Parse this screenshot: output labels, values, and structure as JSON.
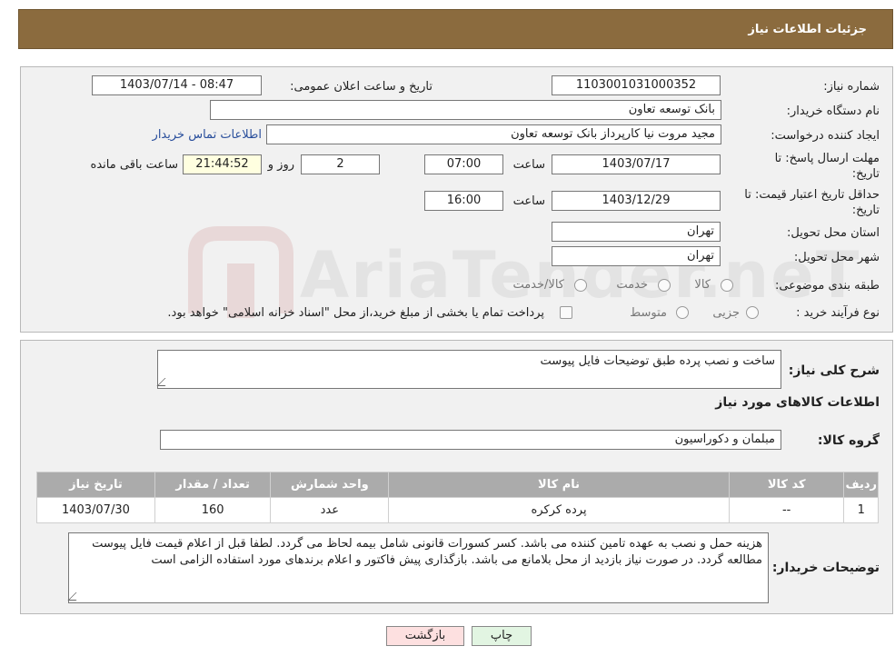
{
  "header": {
    "title": "جزئیات اطلاعات نیاز"
  },
  "details": {
    "need_number_label": "شماره نیاز:",
    "need_number": "1103001031000352",
    "announce_label": "تاریخ و ساعت اعلان عمومی:",
    "announce_value": "1403/07/14 - 08:47",
    "buyer_label": "نام دستگاه خریدار:",
    "buyer_value": "بانک توسعه تعاون",
    "creator_label": "ایجاد کننده درخواست:",
    "creator_value": "مجید مروت نیا کارپرداز بانک توسعه تعاون",
    "contact_link": "اطلاعات تماس خریدار",
    "deadline_label_1": "مهلت ارسال پاسخ: تا",
    "deadline_label_2": "تاریخ:",
    "deadline_date": "1403/07/17",
    "time_label": "ساعت",
    "deadline_time": "07:00",
    "days_value": "2",
    "days_label": "روز و",
    "remaining_time": "21:44:52",
    "remaining_label": "ساعت باقی مانده",
    "validity_label_1": "حداقل تاریخ اعتبار قیمت: تا",
    "validity_label_2": "تاریخ:",
    "validity_date": "1403/12/29",
    "validity_time": "16:00",
    "province_label": "استان محل تحویل:",
    "province_value": "تهران",
    "city_label": "شهر محل تحویل:",
    "city_value": "تهران",
    "category_label": "طبقه بندی موضوعی:",
    "category_options": [
      "کالا",
      "خدمت",
      "کالا/خدمت"
    ],
    "process_label": "نوع فرآیند خرید :",
    "process_options": [
      "جزیی",
      "متوسط"
    ],
    "process_note": "پرداخت تمام یا بخشی از مبلغ خرید،از محل \"اسناد خزانه اسلامی\" خواهد بود."
  },
  "summary": {
    "general_label": "شرح کلی نیاز:",
    "general_value": "ساخت و نصب پرده طبق توضیحات فایل پیوست",
    "goods_title": "اطلاعات کالاهای مورد نیاز",
    "group_label": "گروه کالا:",
    "group_value": "مبلمان و دکوراسیون",
    "table": {
      "headers": [
        "ردیف",
        "کد کالا",
        "نام کالا",
        "واحد شمارش",
        "تعداد / مقدار",
        "تاریخ نیاز"
      ],
      "rows": [
        [
          "1",
          "--",
          "پرده کرکره",
          "عدد",
          "160",
          "1403/07/30"
        ]
      ]
    },
    "buyer_notes_label": "توضیحات خریدار:",
    "buyer_notes_value": "هزینه حمل و نصب به عهده تامین کننده می باشد. کسر کسورات قانونی شامل بیمه لحاظ می گردد. لطفا قبل از اعلام قیمت فایل پیوست مطالعه گردد. در صورت نیاز بازدید از محل بلامانع می باشد. بازگذاری پیش فاکتور و اعلام برندهای مورد استفاده الزامی است"
  },
  "buttons": {
    "print": "چاپ",
    "back": "بازگشت"
  },
  "watermark": {
    "text": "AriaTender.neT"
  },
  "colors": {
    "header_bg": "#8b6b3e",
    "panel_bg": "#f1f1f1",
    "table_header_bg": "#ababab",
    "back_button_bg": "#fde0e0",
    "print_button_bg": "#e2f5e2",
    "timer_bg": "#ffffe0"
  }
}
